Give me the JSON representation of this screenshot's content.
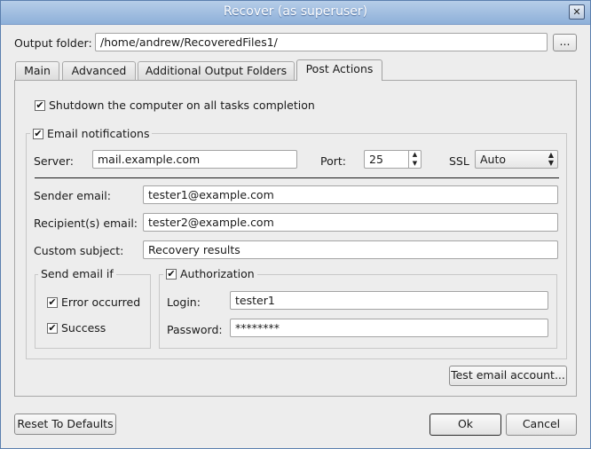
{
  "window": {
    "title": "Recover (as superuser)",
    "close_icon": "close-icon"
  },
  "output": {
    "label": "Output folder:",
    "value": "/home/andrew/RecoveredFiles1/",
    "browse_label": "..."
  },
  "tabs": [
    {
      "label": "Main"
    },
    {
      "label": "Advanced"
    },
    {
      "label": "Additional Output Folders"
    },
    {
      "label": "Post Actions",
      "active": true
    }
  ],
  "post_actions": {
    "shutdown_label": "Shutdown the computer on all tasks completion",
    "shutdown_checked": true,
    "email_group_label": "Email notifications",
    "email_checked": true,
    "server_label": "Server:",
    "server_value": "mail.example.com",
    "port_label": "Port:",
    "port_value": "25",
    "ssl_label": "SSL",
    "ssl_value": "Auto",
    "sender_label": "Sender email:",
    "sender_value": "tester1@example.com",
    "recipient_label": "Recipient(s) email:",
    "recipient_value": "tester2@example.com",
    "subject_label": "Custom subject:",
    "subject_value": "Recovery results",
    "send_if": {
      "label": "Send email if",
      "error_label": "Error occurred",
      "success_label": "Success"
    },
    "auth": {
      "label": "Authorization",
      "login_label": "Login:",
      "login_value": "tester1",
      "password_label": "Password:",
      "password_value": "********"
    },
    "test_button": "Test email account..."
  },
  "footer": {
    "reset_label": "Reset To Defaults",
    "ok_label": "Ok",
    "cancel_label": "Cancel"
  },
  "check_glyph": "✔"
}
